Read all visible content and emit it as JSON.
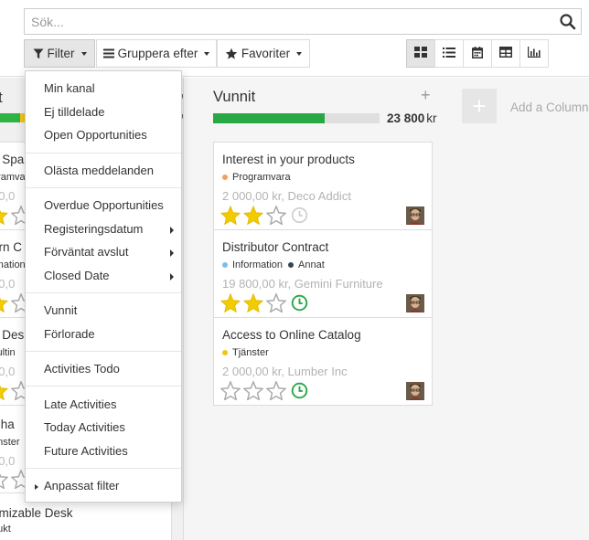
{
  "search": {
    "placeholder": "Sök..."
  },
  "toolbar": {
    "filter_label": "Filter",
    "groupby_label": "Gruppera efter",
    "favorites_label": "Favoriter"
  },
  "view_switcher": [
    "kanban-icon",
    "list-icon",
    "calendar-icon",
    "pivot-icon",
    "graph-icon"
  ],
  "filter_menu": {
    "groups": [
      [
        "Min kanal",
        "Ej tilldelade",
        "Open Opportunities"
      ],
      [
        "Olästa meddelanden"
      ],
      [
        "Overdue Opportunities",
        "Registeringsdatum",
        "Förväntat avslut",
        "Closed Date"
      ],
      [
        "Vunnit",
        "Förlorade"
      ],
      [
        "Activities Todo"
      ],
      [
        "Late Activities",
        "Today Activities",
        "Future Activities"
      ]
    ],
    "items": {
      "min_kanal": "Min kanal",
      "ej_tilldelade": "Ej tilldelade",
      "open_opportunities": "Open Opportunities",
      "olasta": "Olästa meddelanden",
      "overdue": "Overdue Opportunities",
      "registeringsdatum": "Registeringsdatum",
      "forvantat_avslut": "Förväntat avslut",
      "closed_date": "Closed Date",
      "vunnit": "Vunnit",
      "forlorade": "Förlorade",
      "activities_todo": "Activities Todo",
      "late_activities": "Late Activities",
      "today_activities": "Today Activities",
      "future_activities": "Future Activities"
    },
    "custom_filter": "Anpassat filter"
  },
  "left_column_fragments": {
    "header": "t",
    "cards": [
      {
        "title": "n Spa",
        "tag": "gramvara",
        "amount": "00,0",
        "stars": 1
      },
      {
        "title": "ern C",
        "tag": "rmation",
        "amount": "00,0",
        "stars": 1
      },
      {
        "title": "e Des",
        "tag": "sultin",
        "amount": "00,0",
        "stars": 1
      },
      {
        "title": "Cha",
        "tag": "änster",
        "amount": "00,0",
        "stars": 0
      },
      {
        "title": "omizable Desk",
        "tag": "dukt",
        "amount": "",
        "stars": 0
      }
    ]
  },
  "column": {
    "title": "Vunnit",
    "add_symbol": "+",
    "progress_fraction": 0.67,
    "total_amount": "23 800",
    "total_unit": "kr"
  },
  "add_column": {
    "symbol": "+",
    "label": "Add a Column"
  },
  "colors": {
    "progress_green": "#28a745",
    "star_gold": "#f3cc00",
    "clock_green": "#28a745",
    "tag_orange": "#f0a060",
    "tag_blue": "#7fbde8",
    "tag_dark": "#374451",
    "tag_yellow": "#f0c419"
  },
  "cards": [
    {
      "title": "Interest in your products",
      "tags": [
        {
          "label": "Programvara",
          "color": "#f0a060"
        }
      ],
      "amount": "2 000,00 kr, Deco Addict",
      "stars": 2,
      "activity": "none"
    },
    {
      "title": "Distributor Contract",
      "tags": [
        {
          "label": "Information",
          "color": "#7fbde8"
        },
        {
          "label": "Annat",
          "color": "#374451"
        }
      ],
      "amount": "19 800,00 kr, Gemini Furniture",
      "stars": 2,
      "activity": "planned"
    },
    {
      "title": "Access to Online Catalog",
      "tags": [
        {
          "label": "Tjänster",
          "color": "#f0c419"
        }
      ],
      "amount": "2 000,00 kr, Lumber Inc",
      "stars": 0,
      "activity": "planned"
    }
  ]
}
